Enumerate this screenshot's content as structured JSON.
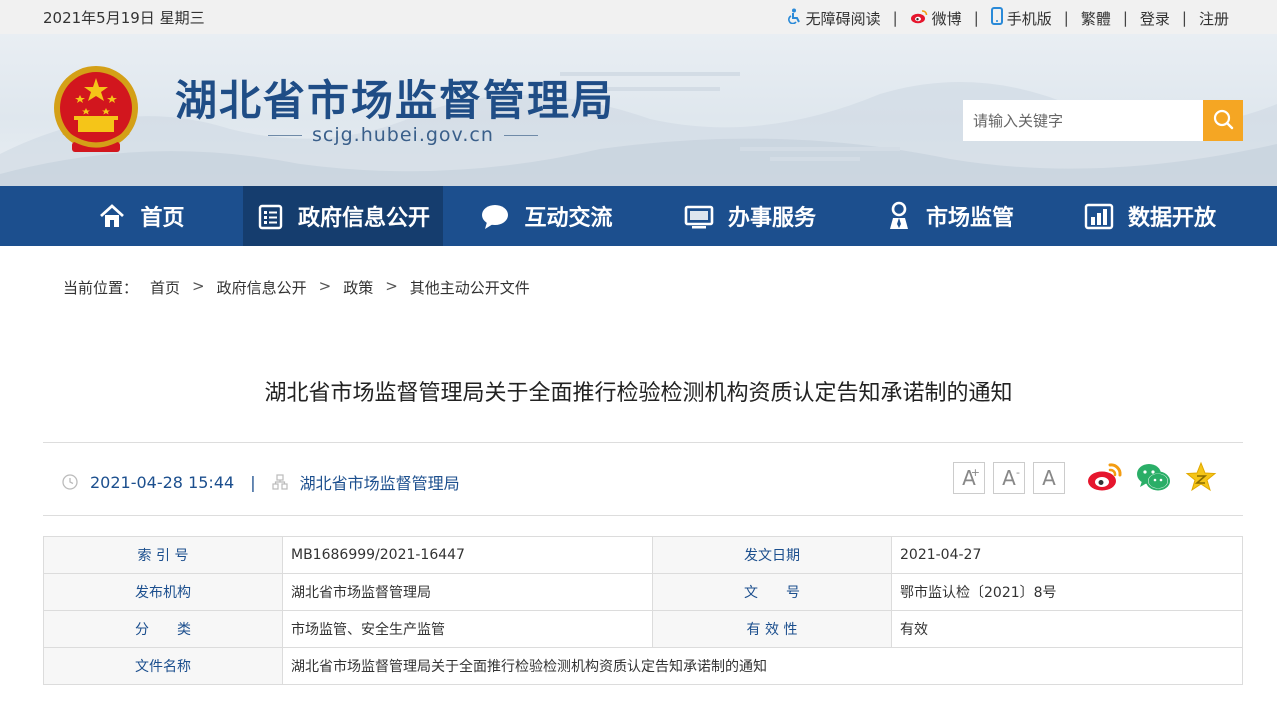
{
  "topbar": {
    "date": "2021年5月19日 星期三",
    "links": [
      "无障碍阅读",
      "微博",
      "手机版",
      "繁體",
      "登录",
      "注册"
    ]
  },
  "header": {
    "site_title": "湖北省市场监督管理局",
    "site_url": "scjg.hubei.gov.cn",
    "search_placeholder": "请输入关键字"
  },
  "nav": {
    "items": [
      "首页",
      "政府信息公开",
      "互动交流",
      "办事服务",
      "市场监管",
      "数据开放"
    ],
    "active": "政府信息公开"
  },
  "breadcrumb": {
    "label": "当前位置：",
    "items": [
      "首页",
      "政府信息公开",
      "政策",
      "其他主动公开文件"
    ]
  },
  "article": {
    "title": "湖北省市场监督管理局关于全面推行检验检测机构资质认定告知承诺制的通知",
    "datetime": "2021-04-28 15:44",
    "source": "湖北省市场监督管理局"
  },
  "font_buttons": [
    "A",
    "A",
    "A"
  ],
  "info_table": {
    "index_label": "索 引 号",
    "index_value": "MB1686999/2021-16447",
    "issue_date_label": "发文日期",
    "issue_date_value": "2021-04-27",
    "publisher_label": "发布机构",
    "publisher_value": "湖北省市场监督管理局",
    "doc_no_label": "文　　号",
    "doc_no_value": "鄂市监认检〔2021〕8号",
    "category_label": "分　　类",
    "category_value": "市场监管、安全生产监管",
    "validity_label": "有 效 性",
    "validity_value": "有效",
    "filename_label": "文件名称",
    "filename_value": "湖北省市场监督管理局关于全面推行检验检测机构资质认定告知承诺制的通知"
  },
  "colors": {
    "nav_bg": "#1c4f8e",
    "nav_active": "#153d6e",
    "accent": "#f5a623",
    "title_blue": "#1f4d86"
  }
}
